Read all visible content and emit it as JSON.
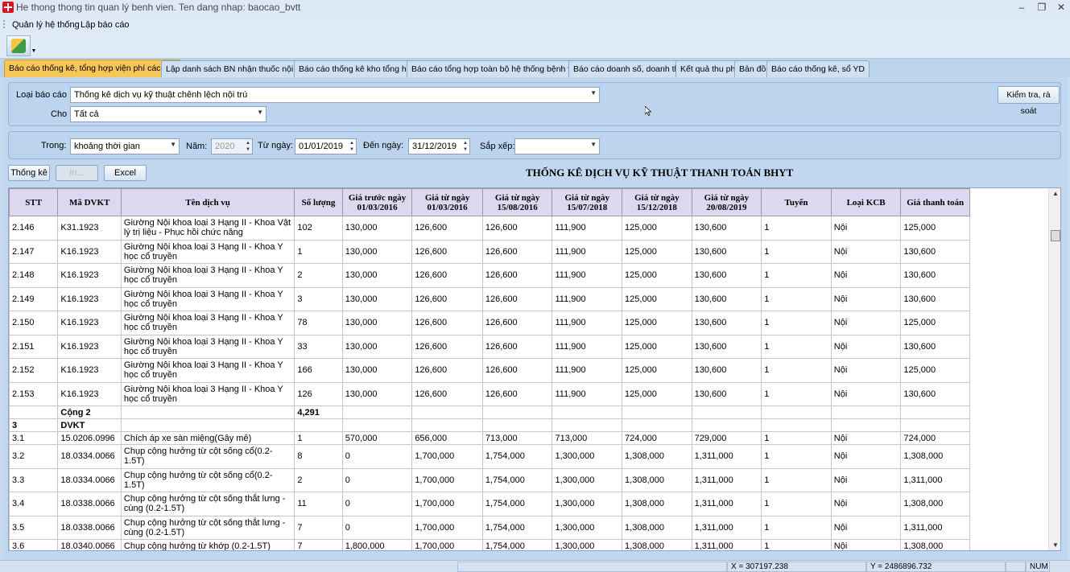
{
  "window": {
    "title": "He thong thong tin quan lý benh vien. Ten dang nhap: baocao_bvtt",
    "minimize": "–",
    "restore": "❐",
    "close": "✕"
  },
  "menu": {
    "items": [
      "Quản lý hệ thống",
      "Lập báo cáo"
    ]
  },
  "tabs": [
    "Báo cáo thống kê, tổng hợp viện phí các loại",
    "Lập danh sách BN nhận thuốc nội trú",
    "Báo cáo thống kê kho tổng hợp",
    "Báo cáo tổng hợp toàn bộ hệ thống bệnh viện",
    "Báo cáo doanh số, doanh thu",
    "Kết quả thu phí",
    "Bản đồ",
    "Báo cáo thống kê, sổ YD"
  ],
  "filters": {
    "report_type_label": "Loại báo cáo",
    "report_type_value": "Thống kê dịch vụ kỹ thuật chênh lệch nội trú",
    "for_label": "Cho",
    "for_value": "Tất cả",
    "check_button": "Kiểm tra, rà soát",
    "in_label": "Trong:",
    "in_value": "khoảng thời gian",
    "year_label": "Năm:",
    "year_value": "2020",
    "from_label": "Từ ngày:",
    "from_value": "01/01/2019",
    "to_label": "Đến ngày:",
    "to_value": "31/12/2019",
    "sort_label": "Sắp xếp:",
    "sort_value": ""
  },
  "actions": {
    "stats": "Thống kê",
    "print": "In...",
    "excel": "Excel"
  },
  "report_title": "THỐNG KÊ DỊCH VỤ KỸ THUẬT THANH TOÁN BHYT",
  "table": {
    "columns": [
      "STT",
      "Mã DVKT",
      "Tên dịch vụ",
      "Số lượng",
      "Giá trước ngày 01/03/2016",
      "Giá từ ngày 01/03/2016",
      "Giá từ ngày 15/08/2016",
      "Giá từ ngày 15/07/2018",
      "Giá từ ngày 15/12/2018",
      "Giá từ ngày 20/08/2019",
      "Tuyến",
      "Loại KCB",
      "Giá thanh toán"
    ],
    "rows": [
      [
        "2.146",
        "K31.1923",
        "Giường Nội khoa loại 3 Hạng II - Khoa Vật lý trị liệu - Phục hồi chức năng",
        "102",
        "130,000",
        "126,600",
        "126,600",
        "111,900",
        "125,000",
        "130,600",
        "1",
        "Nội",
        "125,000"
      ],
      [
        "2.147",
        "K16.1923",
        "Giường Nội khoa loại 3 Hạng II - Khoa Y học cổ truyền",
        "1",
        "130,000",
        "126,600",
        "126,600",
        "111,900",
        "125,000",
        "130,600",
        "1",
        "Nội",
        "130,600"
      ],
      [
        "2.148",
        "K16.1923",
        "Giường Nội khoa loại 3 Hạng II - Khoa Y học cổ truyền",
        "2",
        "130,000",
        "126,600",
        "126,600",
        "111,900",
        "125,000",
        "130,600",
        "1",
        "Nội",
        "130,600"
      ],
      [
        "2.149",
        "K16.1923",
        "Giường Nội khoa loại 3 Hạng II - Khoa Y học cổ truyền",
        "3",
        "130,000",
        "126,600",
        "126,600",
        "111,900",
        "125,000",
        "130,600",
        "1",
        "Nội",
        "130,600"
      ],
      [
        "2.150",
        "K16.1923",
        "Giường Nội khoa loại 3 Hạng II - Khoa Y học cổ truyền",
        "78",
        "130,000",
        "126,600",
        "126,600",
        "111,900",
        "125,000",
        "130,600",
        "1",
        "Nội",
        "125,000"
      ],
      [
        "2.151",
        "K16.1923",
        "Giường Nội khoa loại 3 Hạng II - Khoa Y học cổ truyền",
        "33",
        "130,000",
        "126,600",
        "126,600",
        "111,900",
        "125,000",
        "130,600",
        "1",
        "Nội",
        "130,600"
      ],
      [
        "2.152",
        "K16.1923",
        "Giường Nội khoa loại 3 Hạng II - Khoa Y học cổ truyền",
        "166",
        "130,000",
        "126,600",
        "126,600",
        "111,900",
        "125,000",
        "130,600",
        "1",
        "Nội",
        "125,000"
      ],
      [
        "2.153",
        "K16.1923",
        "Giường Nội khoa loại 3 Hạng II - Khoa Y học cổ truyền",
        "126",
        "130,000",
        "126,600",
        "126,600",
        "111,900",
        "125,000",
        "130,600",
        "1",
        "Nội",
        "130,600"
      ],
      [
        "",
        "Cộng 2",
        "",
        "4,291",
        "",
        "",
        "",
        "",
        "",
        "",
        "",
        "",
        ""
      ],
      [
        "3",
        "DVKT",
        "",
        "",
        "",
        "",
        "",
        "",
        "",
        "",
        "",
        "",
        ""
      ],
      [
        "3.1",
        "15.0206.0996",
        "Chích áp xe sàn miệng(Gây mê)",
        "1",
        "570,000",
        "656,000",
        "713,000",
        "713,000",
        "724,000",
        "729,000",
        "1",
        "Nội",
        "724,000"
      ],
      [
        "3.2",
        "18.0334.0066",
        "Chụp cộng hưởng từ cột sống cổ(0.2-1.5T)",
        "8",
        "0",
        "1,700,000",
        "1,754,000",
        "1,300,000",
        "1,308,000",
        "1,311,000",
        "1",
        "Nội",
        "1,308,000"
      ],
      [
        "3.3",
        "18.0334.0066",
        "Chụp cộng hưởng từ cột sống cổ(0.2-1.5T)",
        "2",
        "0",
        "1,700,000",
        "1,754,000",
        "1,300,000",
        "1,308,000",
        "1,311,000",
        "1",
        "Nội",
        "1,311,000"
      ],
      [
        "3.4",
        "18.0338.0066",
        "Chụp cộng hưởng từ cột sống thắt lưng - cùng (0.2-1.5T)",
        "11",
        "0",
        "1,700,000",
        "1,754,000",
        "1,300,000",
        "1,308,000",
        "1,311,000",
        "1",
        "Nội",
        "1,308,000"
      ],
      [
        "3.5",
        "18.0338.0066",
        "Chụp cộng hưởng từ cột sống thắt lưng - cùng (0.2-1.5T)",
        "7",
        "0",
        "1,700,000",
        "1,754,000",
        "1,300,000",
        "1,308,000",
        "1,311,000",
        "1",
        "Nội",
        "1,311,000"
      ],
      [
        "3.6",
        "18.0340.0066",
        "Chụp cộng hưởng từ khớp (0.2-1.5T)",
        "7",
        "1,800,000",
        "1,700,000",
        "1,754,000",
        "1,300,000",
        "1,308,000",
        "1,311,000",
        "1",
        "Nội",
        "1,308,000"
      ]
    ]
  },
  "status": {
    "x": "X = 307197.238",
    "y": "Y = 2486896.732",
    "num": "NUM"
  },
  "icons": {
    "app": "hospital-cross-icon",
    "tool": "report-tool-icon",
    "cursor": "mouse-cursor-icon"
  }
}
